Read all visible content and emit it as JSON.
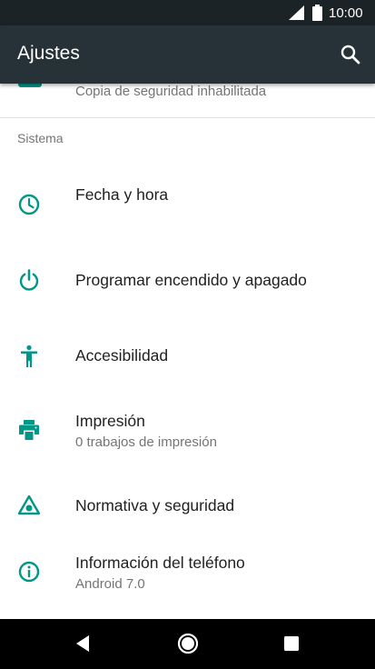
{
  "status_bar": {
    "time": "10:00",
    "icons": [
      "signal-icon",
      "battery-icon"
    ]
  },
  "app_bar": {
    "title": "Ajustes",
    "search_icon": "search-icon"
  },
  "partial_item": {
    "secondary": "Copia de seguridad inhabilitada"
  },
  "section": {
    "title": "Sistema"
  },
  "items": [
    {
      "icon": "clock-icon",
      "primary": "Fecha y hora",
      "secondary": ""
    },
    {
      "icon": "power-icon",
      "primary": "Programar encendido y apagado",
      "secondary": ""
    },
    {
      "icon": "accessibility-icon",
      "primary": "Accesibilidad",
      "secondary": ""
    },
    {
      "icon": "printer-icon",
      "primary": "Impresión",
      "secondary": "0 trabajos de impresión"
    },
    {
      "icon": "regulatory-icon",
      "primary": "Normativa y seguridad",
      "secondary": ""
    },
    {
      "icon": "info-icon",
      "primary": "Información del teléfono",
      "secondary": "Android 7.0"
    }
  ],
  "nav_bar": {
    "icons": [
      "back-icon",
      "home-icon",
      "recents-icon"
    ]
  },
  "colors": {
    "status_bar": "#1c2327",
    "app_bar": "#263238",
    "accent": "#009688",
    "primary_text": "#212121",
    "secondary_text": "#757575",
    "nav_bar": "#000000"
  }
}
